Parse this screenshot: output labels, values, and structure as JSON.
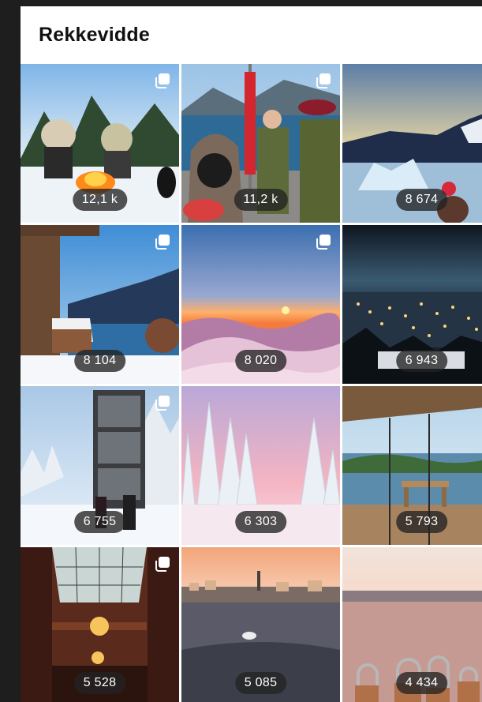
{
  "header": {
    "title": "Rekkevidde"
  },
  "tiles": [
    {
      "value": "12,1 k",
      "multi": true,
      "scene": "campfire"
    },
    {
      "value": "11,2 k",
      "multi": true,
      "scene": "soldiers"
    },
    {
      "value": "8 674",
      "multi": false,
      "scene": "ice-fjord"
    },
    {
      "value": "8 104",
      "multi": true,
      "scene": "cabin-fjord"
    },
    {
      "value": "8 020",
      "multi": true,
      "scene": "sunrise-clouds"
    },
    {
      "value": "6 943",
      "multi": false,
      "scene": "night-town"
    },
    {
      "value": "6 755",
      "multi": true,
      "scene": "glass-tower"
    },
    {
      "value": "6 303",
      "multi": false,
      "scene": "snowy-forest"
    },
    {
      "value": "5 793",
      "multi": false,
      "scene": "glass-balcony"
    },
    {
      "value": "5 528",
      "multi": true,
      "scene": "hall-interior"
    },
    {
      "value": "5 085",
      "multi": false,
      "scene": "harbor-sunset"
    },
    {
      "value": "4 434",
      "multi": false,
      "scene": "love-locks"
    }
  ]
}
